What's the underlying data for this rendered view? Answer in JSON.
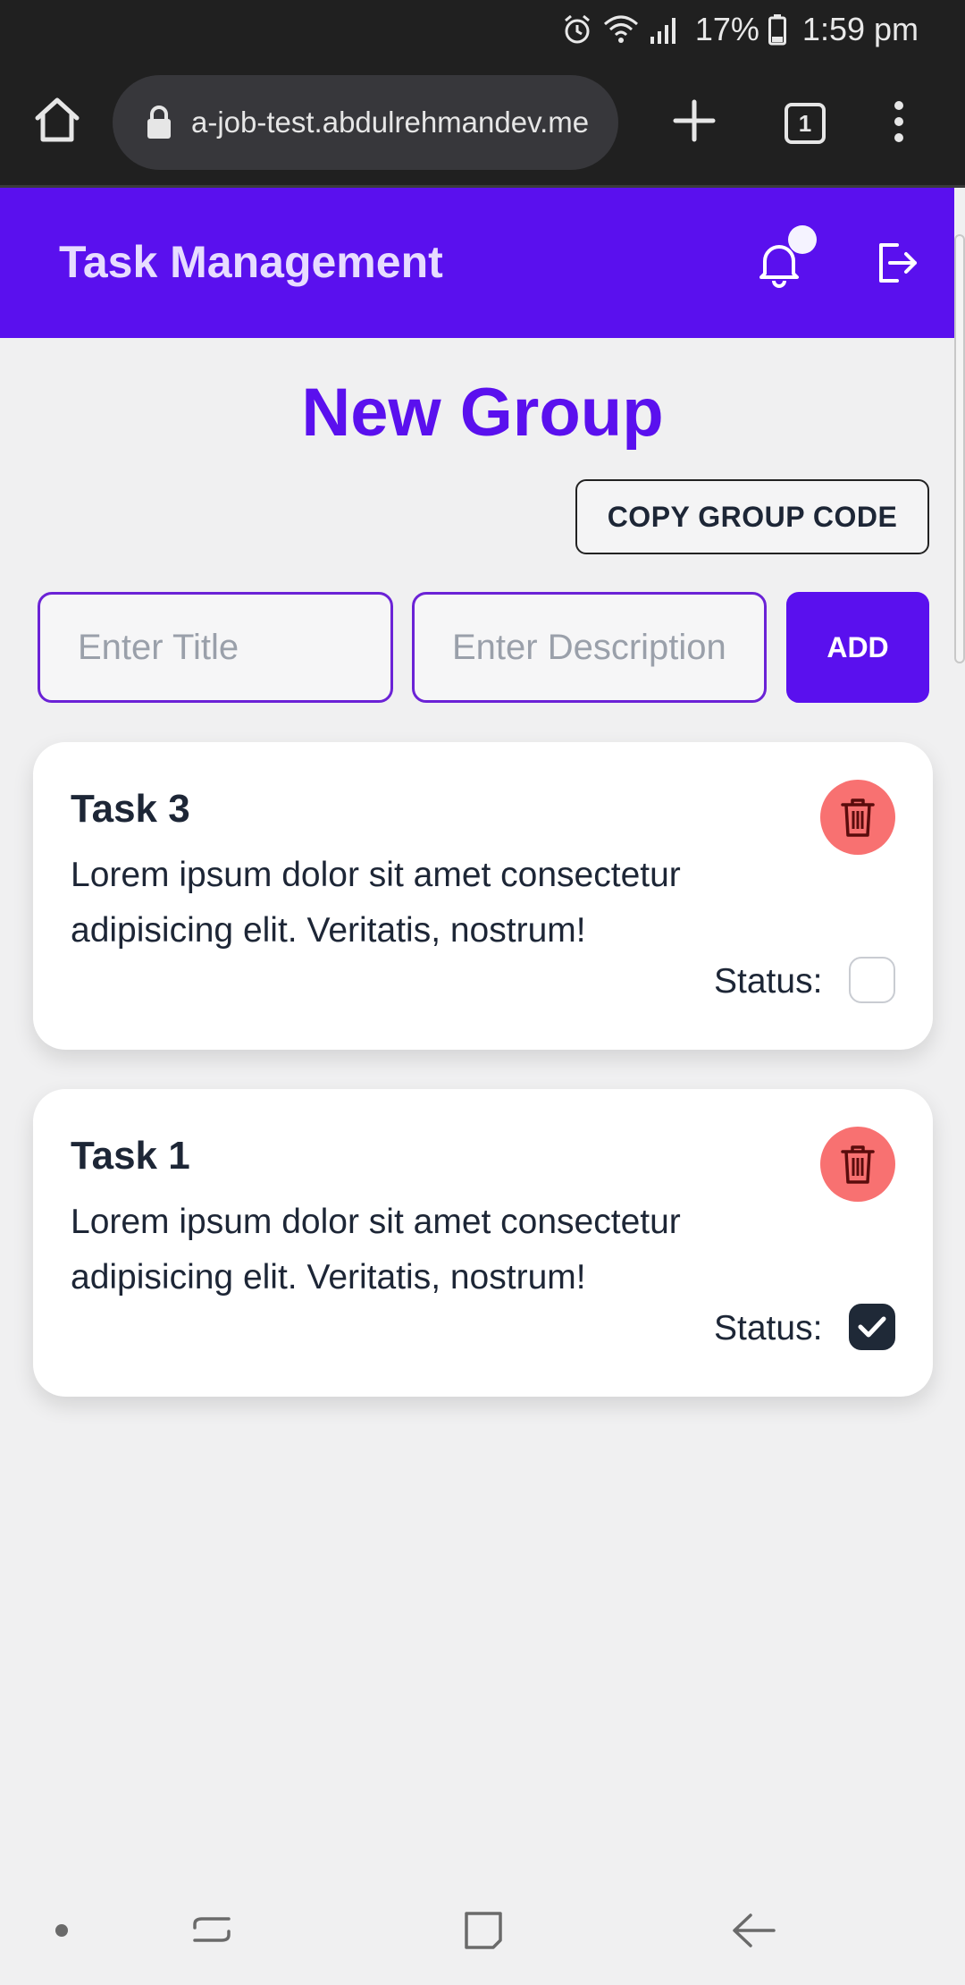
{
  "status_bar": {
    "battery_percent": "17%",
    "time": "1:59 pm",
    "icons": [
      "alarm-icon",
      "wifi-icon",
      "signal-icon",
      "battery-icon"
    ]
  },
  "browser": {
    "url": "a-job-test.abdulrehmandev.me",
    "tab_count": "1",
    "icons": [
      "home-icon",
      "lock-icon",
      "new-tab-icon",
      "tab-switcher-icon",
      "menu-icon"
    ]
  },
  "header": {
    "title": "Task Management",
    "accent_color": "#5a10ee",
    "icons": [
      "bell-icon",
      "logout-icon"
    ]
  },
  "group": {
    "title": "New Group",
    "copy_code_label": "COPY GROUP CODE"
  },
  "form": {
    "title_placeholder": "Enter Title",
    "description_placeholder": "Enter Description",
    "add_label": "ADD"
  },
  "tasks": [
    {
      "title": "Task 3",
      "description": "Lorem ipsum dolor sit amet consectetur adipisicing elit. Veritatis, nostrum!",
      "status_label": "Status:",
      "completed": false
    },
    {
      "title": "Task 1",
      "description": "Lorem ipsum dolor sit amet consectetur adipisicing elit. Veritatis, nostrum!",
      "status_label": "Status:",
      "completed": true
    }
  ],
  "colors": {
    "delete_button": "#f87171",
    "checked_box": "#1f2937"
  }
}
